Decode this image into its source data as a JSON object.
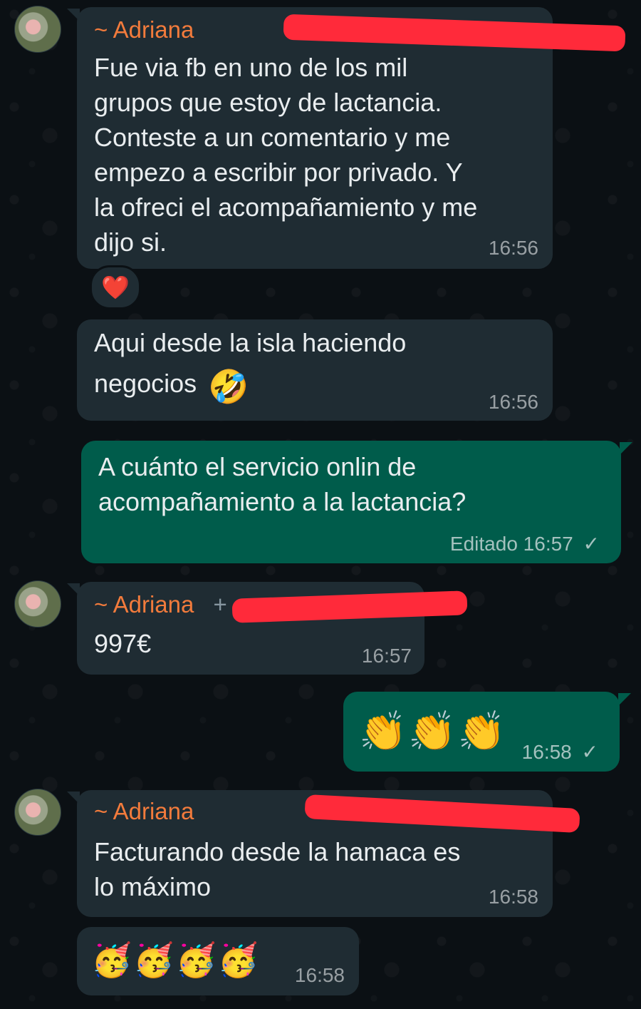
{
  "contact": {
    "name": "~ Adriana"
  },
  "messages": {
    "m1": {
      "sender": "~ Adriana",
      "lines": [
        "Fue via fb en uno de los mil",
        "grupos que estoy de lactancia.",
        "Conteste a un comentario y me",
        "empezo a escribir por privado. Y",
        "la ofreci el acompañamiento y me",
        "dijo si."
      ],
      "time": "16:56",
      "reaction": "❤️"
    },
    "m2": {
      "text_1": "Aqui desde la isla haciendo",
      "text_2": "negocios",
      "emoji": "🤣",
      "time": "16:56"
    },
    "m3": {
      "lines": [
        "A cuánto el servicio onlin de",
        "acompañamiento a la lactancia?"
      ],
      "edited_label": "Editado",
      "time": "16:57",
      "status_icon": "✓"
    },
    "m4": {
      "sender": "~ Adriana",
      "phone_prefix": "+",
      "text": "997€",
      "time": "16:57"
    },
    "m5": {
      "emoji": "👏👏👏",
      "time": "16:58",
      "status_icon": "✓"
    },
    "m6": {
      "sender": "~ Adriana",
      "lines": [
        "Facturando desde la hamaca es",
        "lo máximo"
      ],
      "time": "16:58"
    },
    "m7": {
      "emoji": "🥳🥳🥳🥳",
      "time": "16:58"
    }
  },
  "colors": {
    "background": "#0b1014",
    "incoming_bubble": "#1f2c33",
    "outgoing_bubble": "#005c4b",
    "sender_name": "#f27b3c",
    "redaction": "#ff2a3a"
  }
}
